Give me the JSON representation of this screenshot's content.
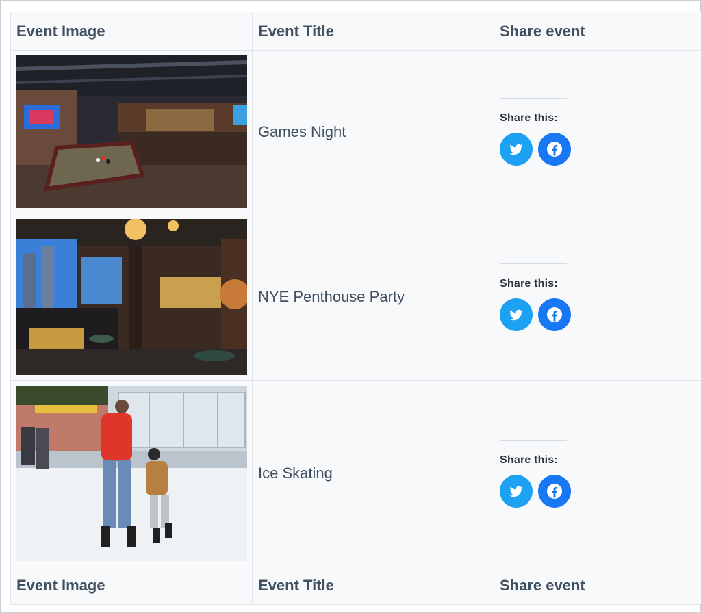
{
  "table": {
    "headers": [
      "Event Image",
      "Event Title",
      "Share event"
    ],
    "footers": [
      "Event Image",
      "Event Title",
      "Share event"
    ],
    "rows": [
      {
        "title": "Games Night",
        "share_label": "Share this:",
        "image_icon": "billiards-bar-photo",
        "icons": [
          "twitter-icon",
          "facebook-icon"
        ]
      },
      {
        "title": "NYE Penthouse Party",
        "share_label": "Share this:",
        "image_icon": "penthouse-lounge-photo",
        "icons": [
          "twitter-icon",
          "facebook-icon"
        ]
      },
      {
        "title": "Ice Skating",
        "share_label": "Share this:",
        "image_icon": "ice-skating-photo",
        "icons": [
          "twitter-icon",
          "facebook-icon"
        ]
      }
    ]
  },
  "colors": {
    "header_text": "#3f5061",
    "twitter": "#1da1f2",
    "facebook": "#1877f2",
    "table_bg": "#f8f9fb"
  }
}
